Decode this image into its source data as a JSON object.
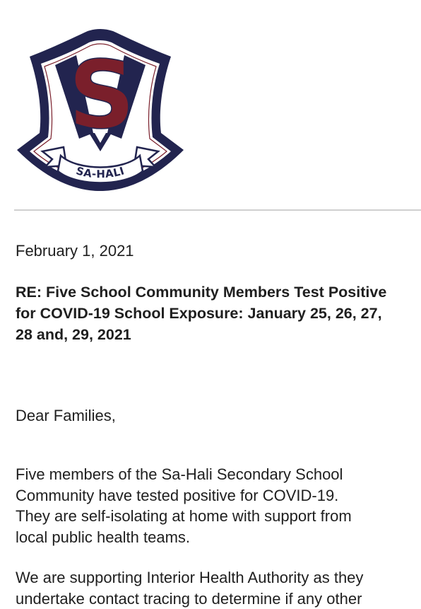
{
  "logo": {
    "icon": "school-crest-logo",
    "banner_text": "SA-HALI",
    "letter": "S",
    "colors": {
      "navy": "#22244f",
      "maroon": "#7a1f2b",
      "white": "#ffffff"
    }
  },
  "letter": {
    "date": "February 1, 2021",
    "subject_lines": [
      "RE: Five School Community Members Test Positive",
      "for COVID-19 School Exposure: January 25, 26, 27,",
      "28 and, 29, 2021"
    ],
    "salutation": "Dear Families,",
    "paragraph1_lines": [
      "Five members of the Sa-Hali Secondary School",
      "Community have tested positive for  COVID-19.",
      "They are self-isolating at home with support from",
      "local public health teams."
    ],
    "paragraph2_lines": [
      "We are supporting Interior Health Authority as they",
      "undertake contact tracing to determine if any other"
    ]
  }
}
